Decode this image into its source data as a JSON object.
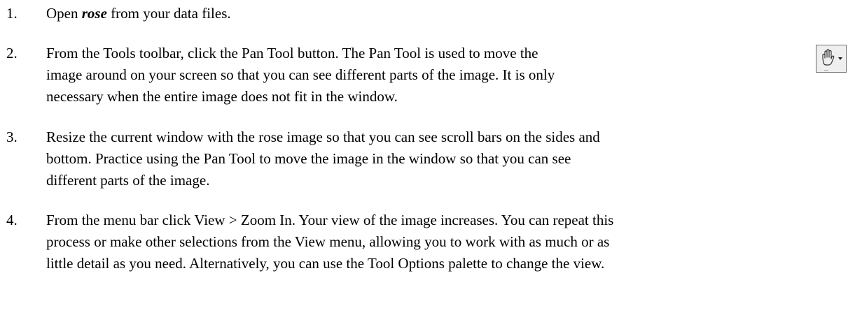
{
  "steps": [
    {
      "number": "1.",
      "text_before": "Open ",
      "filename": "rose",
      "text_after": " from your data files."
    },
    {
      "number": "2.",
      "lines": [
        "From the Tools toolbar, click the Pan Tool button. The Pan Tool is used to move the",
        "image around on your screen so that you can see different parts of the image. It is only",
        "necessary when the entire image does not fit in the window."
      ]
    },
    {
      "number": "3.",
      "lines": [
        "Resize the current window with the rose image so that you can see scroll bars on the sides and",
        "bottom. Practice using the Pan Tool to move the image in the window so that you can see",
        "different parts of the image."
      ]
    },
    {
      "number": "4.",
      "lines": [
        "From the menu bar click View > Zoom In. Your view of the image increases. You can repeat this",
        "process or make other selections from the View menu, allowing you to work with as much or as",
        "little detail as you need. Alternatively, you can use the Tool Options palette to change the view."
      ]
    }
  ],
  "pan_tool_button": {
    "icon": "hand-pan-icon",
    "dropdown_icon": "dropdown-arrow-icon"
  }
}
